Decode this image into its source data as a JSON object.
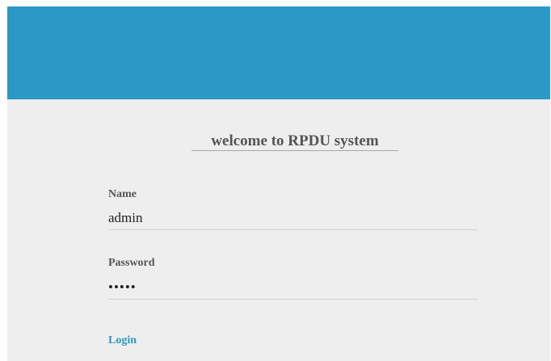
{
  "header": {
    "color": "#2b98c6"
  },
  "login": {
    "title": "welcome to RPDU system",
    "name_label": "Name",
    "name_value": "admin",
    "password_label": "Password",
    "password_value": "•••••",
    "login_label": "Login",
    "accent_color": "#2b98c6",
    "panel_color": "#eeeeee"
  }
}
